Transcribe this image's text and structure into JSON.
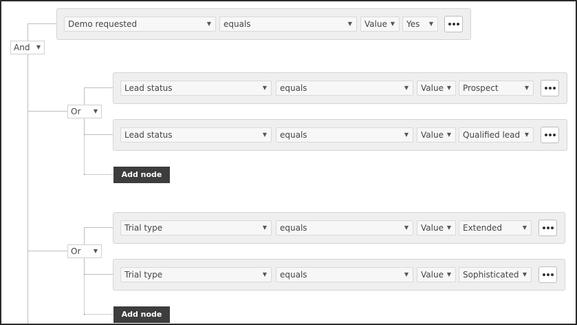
{
  "root": {
    "operator": "And",
    "node": {
      "field": "Demo requested",
      "comparison": "equals",
      "value_type": "Value",
      "value": "Yes"
    }
  },
  "groups": [
    {
      "operator": "Or",
      "nodes": [
        {
          "field": "Lead status",
          "comparison": "equals",
          "value_type": "Value",
          "value": "Prospect"
        },
        {
          "field": "Lead status",
          "comparison": "equals",
          "value_type": "Value",
          "value": "Qualified lead"
        }
      ],
      "add_label": "Add node"
    },
    {
      "operator": "Or",
      "nodes": [
        {
          "field": "Trial type",
          "comparison": "equals",
          "value_type": "Value",
          "value": "Extended"
        },
        {
          "field": "Trial type",
          "comparison": "equals",
          "value_type": "Value",
          "value": "Sophisticated"
        }
      ],
      "add_label": "Add node"
    }
  ],
  "icons": {
    "caret": "caret-down-icon",
    "more": "ellipsis-icon"
  }
}
